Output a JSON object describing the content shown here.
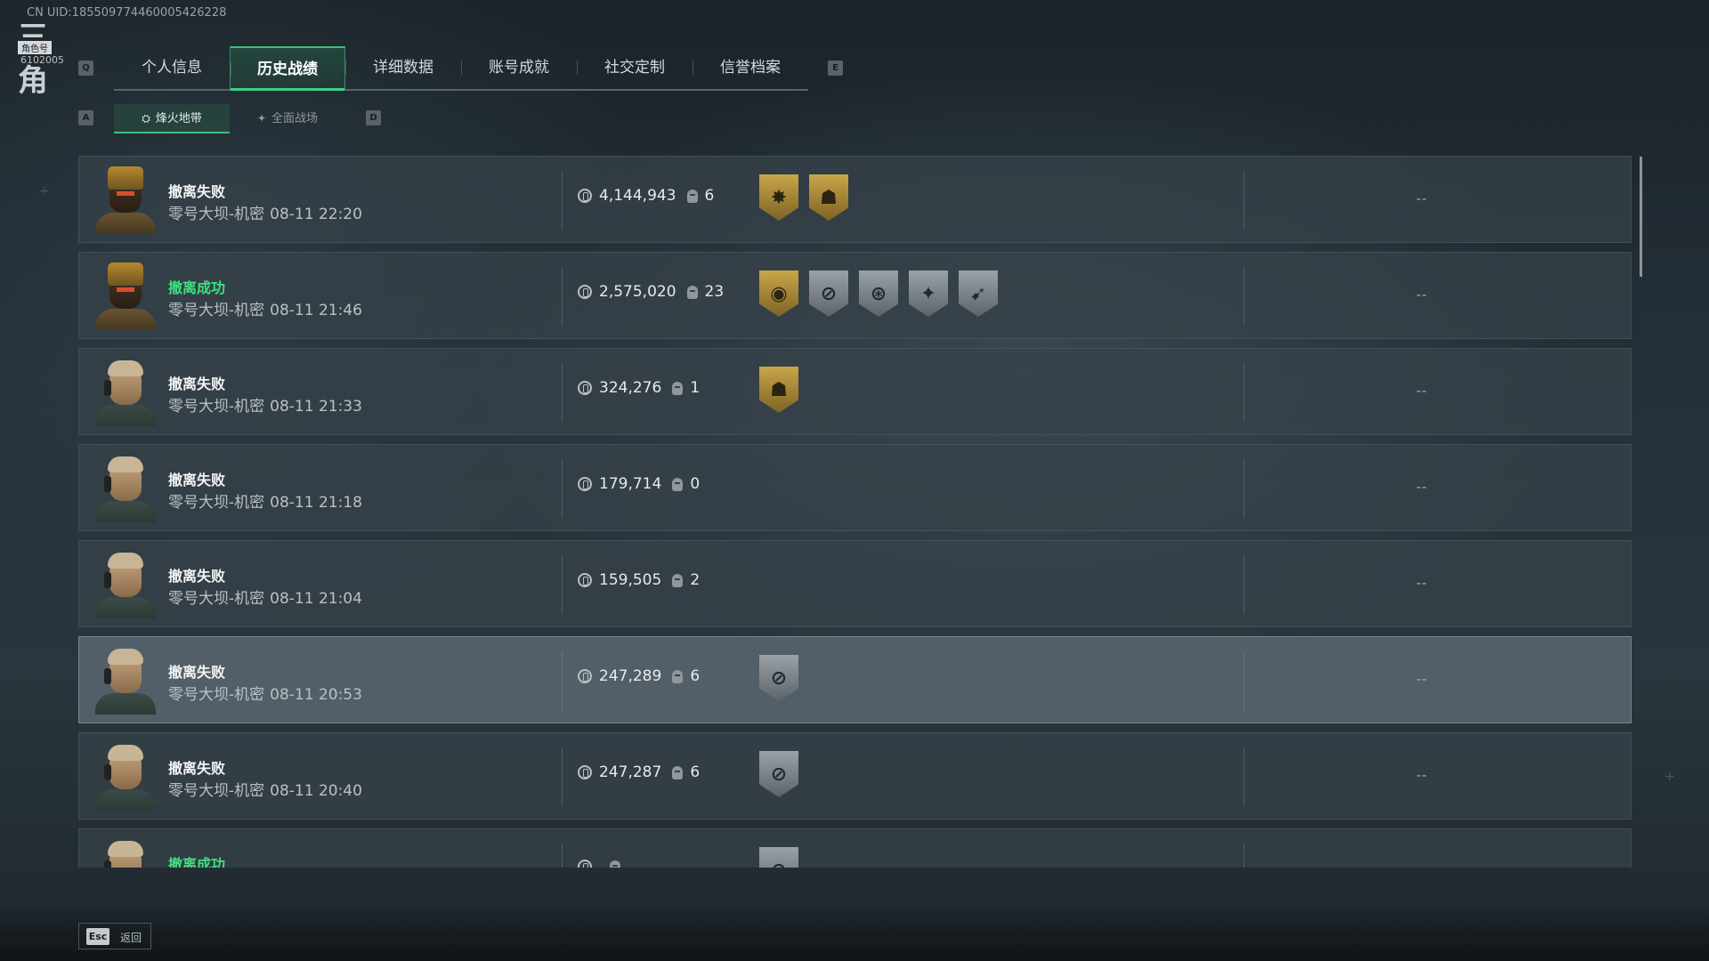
{
  "header": {
    "uid": "CN UID:185509774460005426228",
    "logo_glyph": "三角",
    "logo_tag": "角色号",
    "logo_id": "6102005"
  },
  "tabs": {
    "left_key": "Q",
    "right_key": "E",
    "items": [
      {
        "label": "个人信息",
        "active": false
      },
      {
        "label": "历史战绩",
        "active": true
      },
      {
        "label": "详细数据",
        "active": false
      },
      {
        "label": "账号成就",
        "active": false
      },
      {
        "label": "社交定制",
        "active": false
      },
      {
        "label": "信誉档案",
        "active": false
      }
    ]
  },
  "subtabs": {
    "left_key": "A",
    "right_key": "D",
    "items": [
      {
        "label": "烽火地带",
        "icon": "extraction-icon",
        "active": true
      },
      {
        "label": "全面战场",
        "icon": "battlefield-icon",
        "active": false
      }
    ]
  },
  "records": [
    {
      "status": "撤离失败",
      "success": false,
      "map": "零号大坝-机密",
      "time": "08-11 22:20",
      "value": "4,144,943",
      "kills": "6",
      "avatar": "gold",
      "badges": [
        {
          "icon": "burst-medal-icon",
          "tone": "gold",
          "glyph": "✸"
        },
        {
          "icon": "helmet-medal-icon",
          "tone": "gold",
          "glyph": "☗"
        }
      ],
      "extra": "--"
    },
    {
      "status": "撤离成功",
      "success": true,
      "map": "零号大坝-机密",
      "time": "08-11 21:46",
      "value": "2,575,020",
      "kills": "23",
      "avatar": "gold",
      "badges": [
        {
          "icon": "coin-medal-icon",
          "tone": "gold",
          "glyph": "◉"
        },
        {
          "icon": "crosshair-medal-icon",
          "tone": "gray",
          "glyph": "⊘"
        },
        {
          "icon": "skull-medal-icon",
          "tone": "gray",
          "glyph": "⊛"
        },
        {
          "icon": "star-medal-icon",
          "tone": "gray",
          "glyph": "✦"
        },
        {
          "icon": "gun-medal-icon",
          "tone": "gray",
          "glyph": "➹"
        }
      ],
      "extra": "--"
    },
    {
      "status": "撤离失败",
      "success": false,
      "map": "零号大坝-机密",
      "time": "08-11 21:33",
      "value": "324,276",
      "kills": "1",
      "avatar": "blond",
      "badges": [
        {
          "icon": "helmet-medal-icon",
          "tone": "gold",
          "glyph": "☗"
        }
      ],
      "extra": "--"
    },
    {
      "status": "撤离失败",
      "success": false,
      "map": "零号大坝-机密",
      "time": "08-11 21:18",
      "value": "179,714",
      "kills": "0",
      "avatar": "blond",
      "badges": [],
      "extra": "--"
    },
    {
      "status": "撤离失败",
      "success": false,
      "map": "零号大坝-机密",
      "time": "08-11 21:04",
      "value": "159,505",
      "kills": "2",
      "avatar": "blond",
      "badges": [],
      "extra": "--"
    },
    {
      "status": "撤离失败",
      "success": false,
      "map": "零号大坝-机密",
      "time": "08-11 20:53",
      "value": "247,289",
      "kills": "6",
      "avatar": "blond",
      "highlight": true,
      "badges": [
        {
          "icon": "crosshair-medal-icon",
          "tone": "gray",
          "glyph": "⊘"
        }
      ],
      "extra": "--"
    },
    {
      "status": "撤离失败",
      "success": false,
      "map": "零号大坝-机密",
      "time": "08-11 20:40",
      "value": "247,287",
      "kills": "6",
      "avatar": "blond",
      "badges": [
        {
          "icon": "crosshair-medal-icon",
          "tone": "gray",
          "glyph": "⊘"
        }
      ],
      "extra": "--"
    },
    {
      "status": "撤离成功",
      "success": true,
      "map": "",
      "time": "",
      "value": "",
      "kills": "",
      "avatar": "blond",
      "badges": [
        {
          "icon": "crosshair-medal-icon",
          "tone": "gray",
          "glyph": "⊘"
        }
      ],
      "extra": ""
    }
  ],
  "footer": {
    "esc_key": "Esc",
    "back_label": "返回"
  },
  "colors": {
    "accent_green": "#3ee07f",
    "tab_active_underline": "#3fd08a",
    "badge_gold": "#c9a64a",
    "badge_gray": "#9aa2a8"
  }
}
